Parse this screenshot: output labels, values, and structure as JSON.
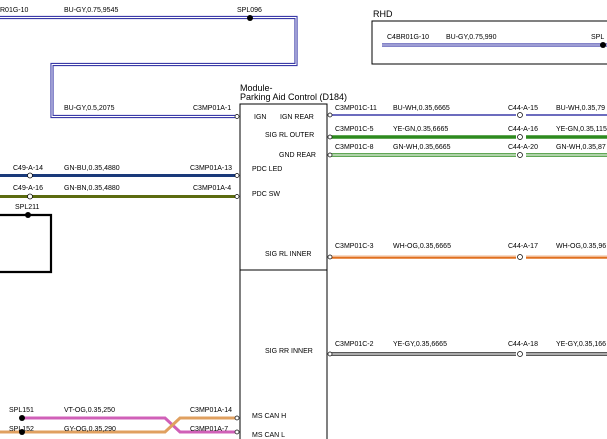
{
  "header": {
    "top_left_connector": "R01G-10",
    "top_left_wire": "BU-GY,0.75,9545",
    "top_splice": "SPL096",
    "rhd_label": "RHD",
    "rhd_connector": "C4BR01G-10",
    "rhd_wire": "BU-GY,0.75,990",
    "rhd_splice": "SPL"
  },
  "module": {
    "title_line1": "Module-",
    "title_line2": "Parking Aid Control (D184)"
  },
  "left_wires": [
    {
      "wire": "BU-GY,0.5,2075",
      "pin": "C3MP01A-1",
      "color": "#3b3ba8",
      "style": "double"
    },
    {
      "connector": "C49-A-14",
      "wire": "GN-BU,0.35,4880",
      "pin": "C3MP01A-13",
      "color": "#1a3a7a",
      "style": "thick"
    },
    {
      "connector": "C49-A-16",
      "wire": "GN-BN,0.35,4880",
      "pin": "C3MP01A-4",
      "color": "#5c6b10",
      "style": "thick"
    }
  ],
  "splices": {
    "spl211": "SPL211",
    "spl151": "SPL151",
    "spl152": "SPL152"
  },
  "can_wires": [
    {
      "wire": "VT-OG,0.35,250",
      "pin": "C3MP01A-14"
    },
    {
      "wire": "GY-OG,0.35,290",
      "pin": "C3MP01A-7"
    }
  ],
  "module_pins": {
    "ign": "IGN",
    "ign_rear": "IGN REAR",
    "sig_rl_outer": "SIG RL OUTER",
    "gnd_rear": "GND REAR",
    "pdc_led": "PDC LED",
    "pdc_sw": "PDC SW",
    "sig_rl_inner": "SIG RL INNER",
    "sig_rr_inner": "SIG RR INNER",
    "ms_can_h": "MS CAN H",
    "ms_can_l": "MS CAN L"
  },
  "right_wires": [
    {
      "pin": "C3MP01C-11",
      "wire": "BU-WH,0.35,6665",
      "connector": "C44-A-15",
      "wire2": "BU-WH,0.35,79",
      "color": "#3b3ba8"
    },
    {
      "pin": "C3MP01C-5",
      "wire": "YE-GN,0.35,6665",
      "connector": "C44-A-16",
      "wire2": "YE-GN,0.35,115",
      "color": "#2d8a1e"
    },
    {
      "pin": "C3MP01C-8",
      "wire": "GN-WH,0.35,6665",
      "connector": "C44-A-20",
      "wire2": "GN-WH,0.35,87",
      "color": "#2d8a1e"
    },
    {
      "pin": "C3MP01C-3",
      "wire": "WH-OG,0.35,6665",
      "connector": "C44-A-17",
      "wire2": "WH-OG,0.35,96",
      "color": "#e07020"
    },
    {
      "pin": "C3MP01C-2",
      "wire": "YE-GY,0.35,6665",
      "connector": "C44-A-18",
      "wire2": "YE-GY,0.35,166",
      "color": "#555555"
    }
  ]
}
